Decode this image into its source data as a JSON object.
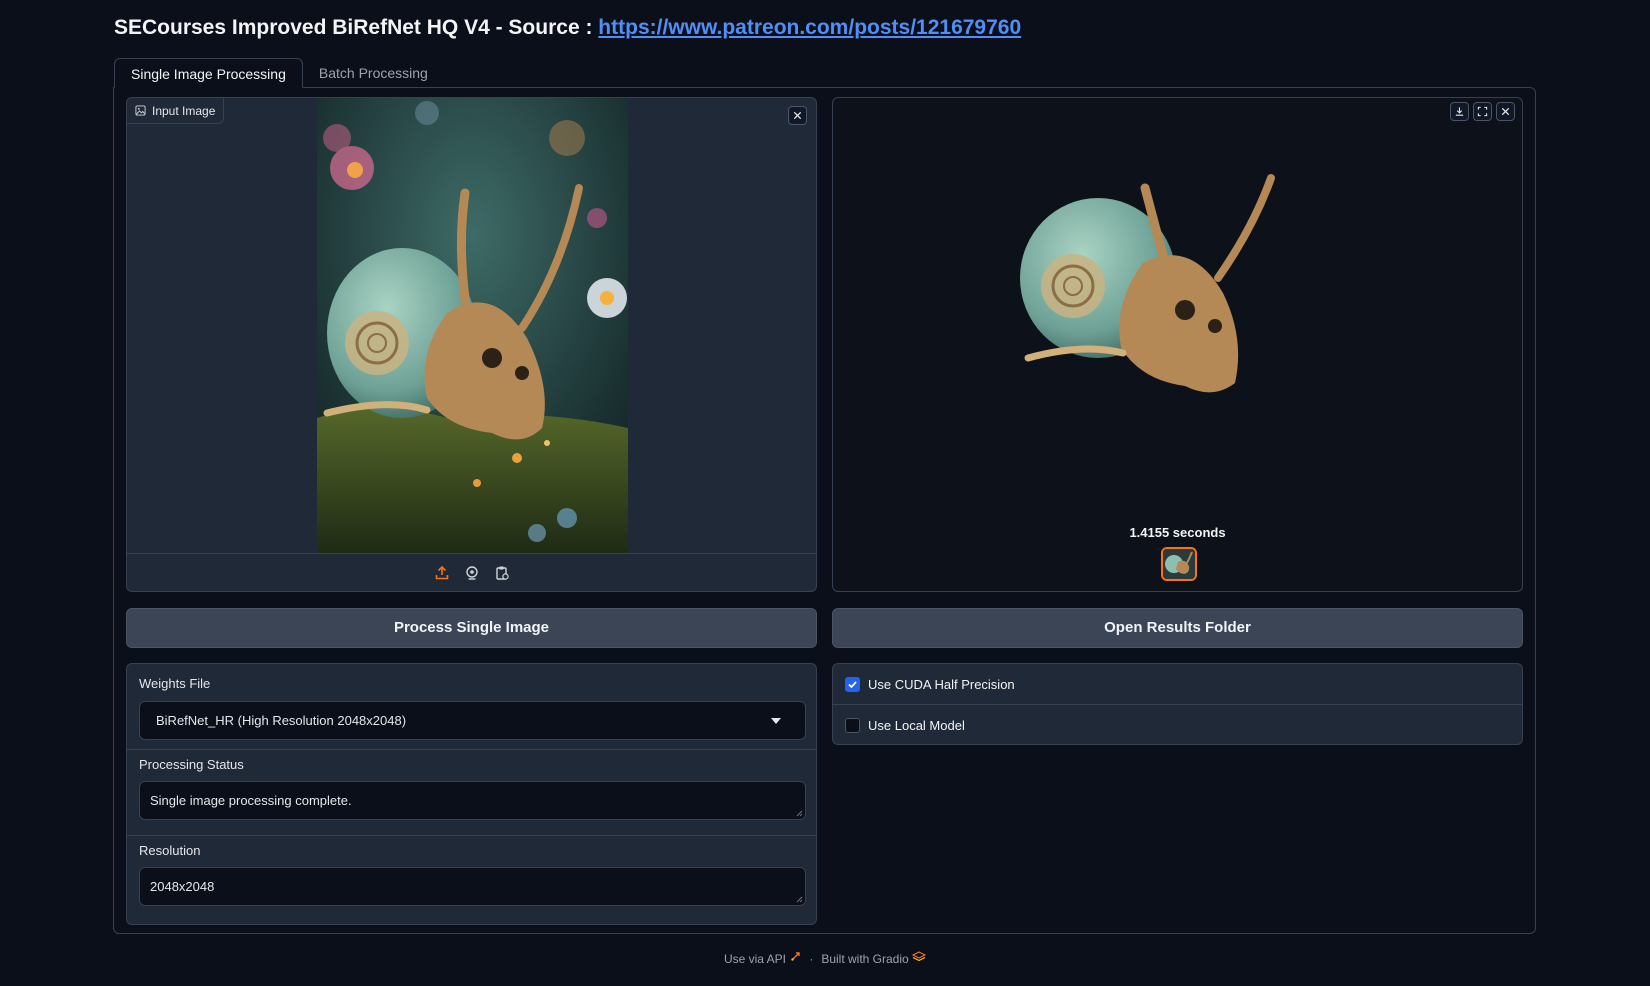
{
  "title": {
    "text": "SECourses Improved BiRefNet HQ V4 - Source : ",
    "link_text": "https://www.patreon.com/posts/121679760"
  },
  "tabs": [
    {
      "label": "Single Image Processing",
      "active": true
    },
    {
      "label": "Batch Processing",
      "active": false
    }
  ],
  "input_image": {
    "label": "Input Image",
    "icon": "image-icon",
    "toolbar_icons": [
      "upload-icon",
      "webcam-icon",
      "clipboard-icon"
    ]
  },
  "output_image": {
    "caption": "1.4155 seconds",
    "toolbar_icons": [
      "download-icon",
      "fullscreen-icon",
      "close-icon"
    ]
  },
  "buttons": {
    "process": "Process Single Image",
    "open_results": "Open Results Folder"
  },
  "weights": {
    "label": "Weights File",
    "value": "BiRefNet_HR (High Resolution 2048x2048)"
  },
  "status": {
    "label": "Processing Status",
    "value": "Single image processing complete."
  },
  "resolution": {
    "label": "Resolution",
    "value": "2048x2048"
  },
  "options": {
    "cuda_half": {
      "label": "Use CUDA Half Precision",
      "checked": true
    },
    "local_model": {
      "label": "Use Local Model",
      "checked": false
    }
  },
  "footer": {
    "api": "Use via API",
    "separator": "·",
    "built": "Built with Gradio"
  },
  "colors": {
    "background": "#0b0f19",
    "panel": "#1f2937",
    "accent": "#f97316",
    "link": "#4f8ff7",
    "checkbox": "#2563eb"
  }
}
